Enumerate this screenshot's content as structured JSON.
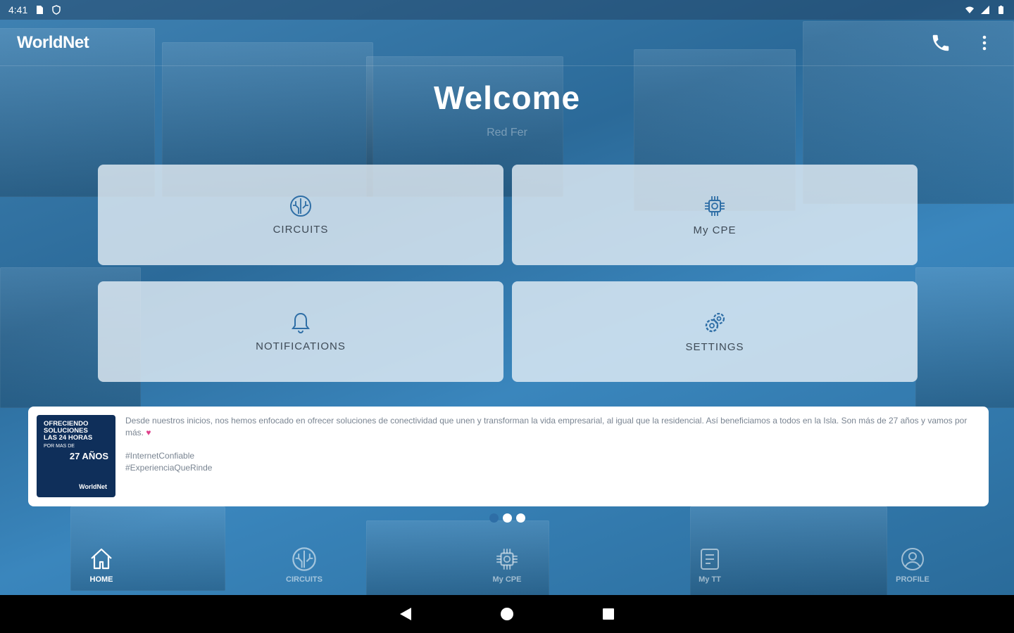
{
  "status_bar": {
    "time": "4:41",
    "icons": [
      "sd-card-icon",
      "shield-icon",
      "wifi-icon",
      "signal-icon",
      "battery-icon"
    ]
  },
  "app_bar": {
    "logo": "WorldNet",
    "actions": [
      "phone-icon",
      "more-vert-icon"
    ]
  },
  "header": {
    "title": "Welcome",
    "subtitle": "Red Fer"
  },
  "tiles": [
    {
      "label": "CIRCUITS",
      "icon": "globe-circuit-icon"
    },
    {
      "label": "My CPE",
      "icon": "chip-icon"
    },
    {
      "label": "NOTIFICATIONS",
      "icon": "bell-icon"
    },
    {
      "label": "SETTINGS",
      "icon": "gears-icon"
    }
  ],
  "news": {
    "thumb": {
      "lines": [
        "OFRECIENDO",
        "SOLUCIONES",
        "LAS 24 HORAS"
      ],
      "small": "POR MAS DE",
      "big": "27 AÑOS",
      "brand": "WorldNet"
    },
    "text": "Desde nuestros inicios, nos hemos enfocado en ofrecer soluciones de conectividad que unen y transforman la vida empresarial, al igual que la residencial. Así beneficiamos a todos en la Isla. Son más de 27 años y vamos por más.",
    "tags": [
      "#InternetConfiable",
      "#ExperienciaQueRinde"
    ]
  },
  "carousel": {
    "count": 3,
    "active": 0
  },
  "bottom_nav": [
    {
      "label": "HOME",
      "icon": "home-icon",
      "active": true
    },
    {
      "label": "CIRCUITS",
      "icon": "globe-circuit-icon",
      "active": false
    },
    {
      "label": "My CPE",
      "icon": "chip-icon",
      "active": false
    },
    {
      "label": "My TT",
      "icon": "ticket-icon",
      "active": false
    },
    {
      "label": "PROFILE",
      "icon": "profile-icon",
      "active": false
    }
  ],
  "system_nav": [
    "back-icon",
    "home-circle-icon",
    "recents-icon"
  ],
  "colors": {
    "accent": "#2e6ea6",
    "heart": "#e0408a",
    "tile_bg": "#ebf2f8"
  }
}
